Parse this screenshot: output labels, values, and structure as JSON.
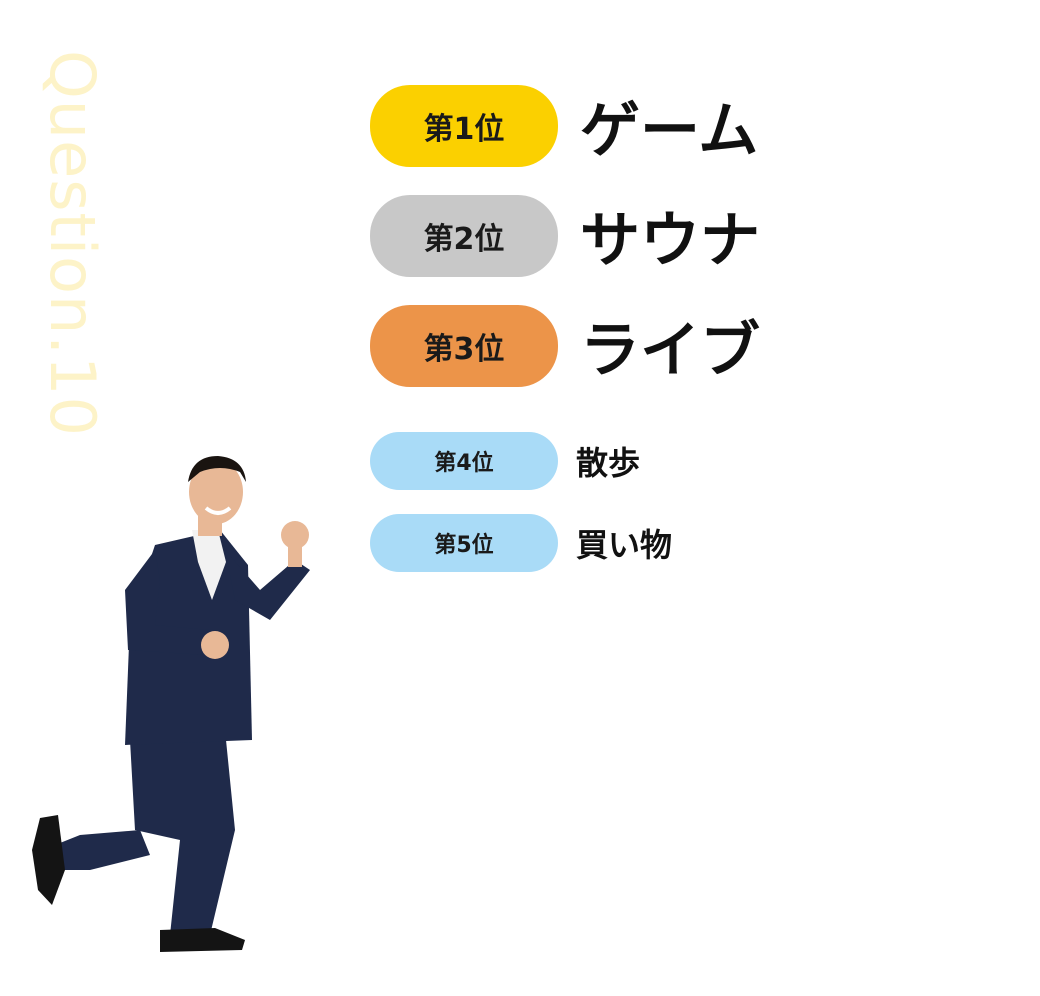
{
  "vertical_label": "Question.10",
  "ranking": [
    {
      "badge": "第1位",
      "item": "ゲーム",
      "color": "#fbd000"
    },
    {
      "badge": "第2位",
      "item": "サウナ",
      "color": "#c8c8c8"
    },
    {
      "badge": "第3位",
      "item": "ライブ",
      "color": "#ec9449"
    },
    {
      "badge": "第4位",
      "item": "散歩",
      "color": "#a9dbf7"
    },
    {
      "badge": "第5位",
      "item": "買い物",
      "color": "#a9dbf7"
    }
  ],
  "figure": {
    "icon": "running-businessman-figure",
    "colors": {
      "suit": "#1f2a4a",
      "skin": "#e8b896",
      "hair": "#1a1410",
      "shirt": "#f2f2f2",
      "shoe": "#141414"
    }
  }
}
